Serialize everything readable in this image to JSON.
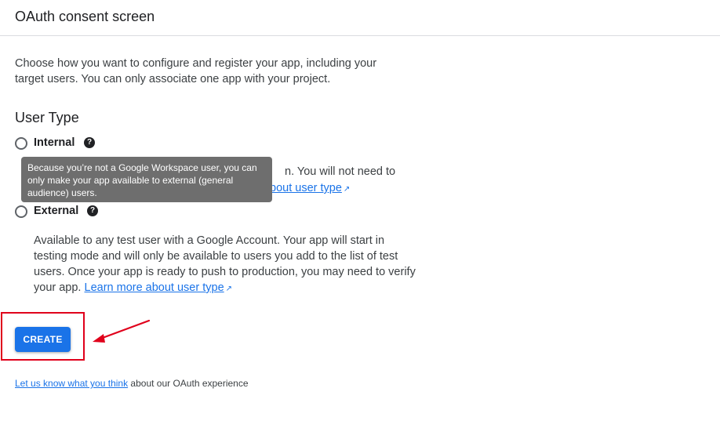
{
  "header": {
    "title": "OAuth consent screen"
  },
  "intro": "Choose how you want to configure and register your app, including your target users. You can only associate one app with your project.",
  "user_type": {
    "heading": "User Type",
    "internal": {
      "label": "Internal",
      "help_icon": "question-circle-icon",
      "description_visible_tail": "n. You will not need to",
      "learn_more_visible_tail": "bout user type"
    },
    "tooltip": "Because you’re not a Google Workspace user, you can only make your app available to external (general audience) users.",
    "external": {
      "label": "External",
      "help_icon": "question-circle-icon",
      "description": "Available to any test user with a Google Account. Your app will start in testing mode and will only be available to users you add to the list of test users. Once your app is ready to push to production, you may need to verify your app.",
      "learn_more": "Learn more about user type"
    }
  },
  "actions": {
    "create_label": "CREATE"
  },
  "feedback": {
    "link": "Let us know what you think",
    "suffix": " about our OAuth experience"
  },
  "colors": {
    "accent": "#1a73e8",
    "annotation": "#e0001b",
    "tooltip_bg": "#6e6e6e"
  }
}
